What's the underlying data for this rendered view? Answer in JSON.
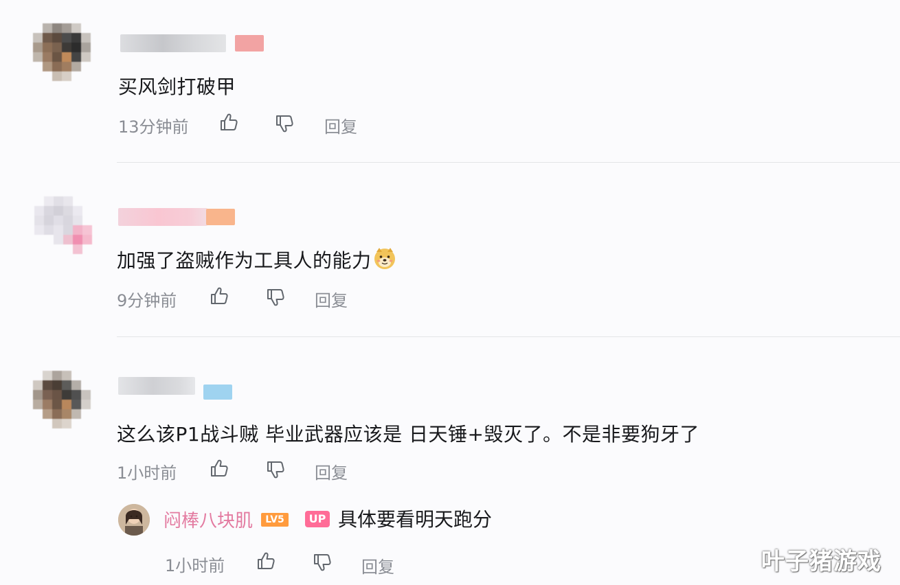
{
  "comments": [
    {
      "text": "买风剑打破甲",
      "time": "13分钟前",
      "reply_label": "回复"
    },
    {
      "text": "加强了盗贼作为工具人的能力",
      "time": "9分钟前",
      "reply_label": "回复"
    },
    {
      "text": "这么该P1战斗贼 毕业武器应该是 日天锤+毁灭了。不是非要狗牙了",
      "time": "1小时前",
      "reply_label": "回复"
    }
  ],
  "sub_reply": {
    "username": "闷棒八块肌",
    "level_badge": "LV5",
    "up_badge": "UP",
    "text": "具体要看明天跑分",
    "time": "1小时前",
    "reply_label": "回复"
  },
  "watermark": "叶子猪游戏",
  "icons": [
    "thumbs-up-icon",
    "thumbs-down-icon",
    "doge-emoji-icon"
  ],
  "colors": {
    "username_pink": "#e37aa0",
    "lv_badge": "#ff9b3d",
    "up_badge": "#ff6c97",
    "meta_gray": "#8a8d94"
  }
}
